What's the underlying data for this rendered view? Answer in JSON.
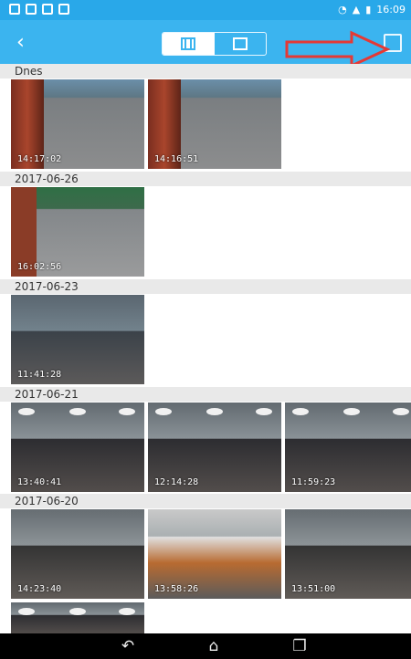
{
  "statusbar": {
    "time": "16:09",
    "signal_icon": "signal-icon",
    "wifi_icon": "wifi-icon",
    "battery_icon": "battery-icon"
  },
  "topbar": {
    "back_icon": "back-arrow-icon",
    "tab_left_icon": "video-grid-icon",
    "tab_right_icon": "image-icon",
    "edit_icon": "edit-icon"
  },
  "annotation": {
    "color": "#e53935"
  },
  "sections": [
    {
      "label": "Dnes",
      "items": [
        {
          "time": "14:17:02"
        },
        {
          "time": "14:16:51"
        }
      ]
    },
    {
      "label": "2017-06-26",
      "items": [
        {
          "time": "16:02:56"
        }
      ]
    },
    {
      "label": "2017-06-23",
      "items": [
        {
          "time": "11:41:28"
        }
      ]
    },
    {
      "label": "2017-06-21",
      "items": [
        {
          "time": "13:40:41"
        },
        {
          "time": "12:14:28"
        },
        {
          "time": "11:59:23"
        }
      ]
    },
    {
      "label": "2017-06-20",
      "items": [
        {
          "time": "14:23:40"
        },
        {
          "time": "13:58:26"
        },
        {
          "time": "13:51:00"
        }
      ]
    }
  ],
  "navbar": {
    "back_icon": "nav-back-icon",
    "home_icon": "nav-home-icon",
    "recents_icon": "nav-recents-icon"
  }
}
